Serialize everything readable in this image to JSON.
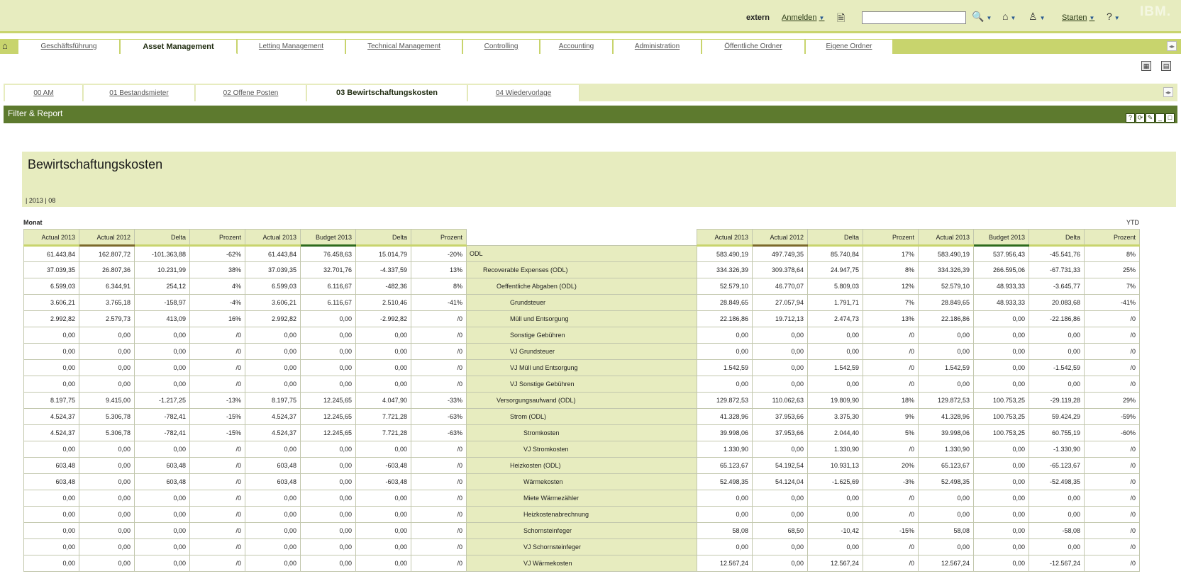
{
  "header": {
    "user": "extern",
    "login_label": "Anmelden",
    "search_value": "",
    "start_label": "Starten",
    "brand": "IBM."
  },
  "main_tabs": [
    {
      "label": "Geschäftsführung"
    },
    {
      "label": "Asset Management"
    },
    {
      "label": "Letting Management"
    },
    {
      "label": "Technical Management"
    },
    {
      "label": "Controlling"
    },
    {
      "label": "Accounting"
    },
    {
      "label": "Administration"
    },
    {
      "label": "Öffentliche Ordner"
    },
    {
      "label": "Eigene Ordner"
    }
  ],
  "active_main_tab": "Asset Management",
  "sub_tabs": [
    {
      "label": "00 AM"
    },
    {
      "label": "01 Bestandsmieter"
    },
    {
      "label": "02 Offene Posten"
    },
    {
      "label": "03 Bewirtschaftungskosten"
    },
    {
      "label": "04 Wiedervorlage"
    }
  ],
  "active_sub_tab": "03 Bewirtschaftungskosten",
  "portlet": {
    "title": "Filter & Report",
    "buttons": [
      "?",
      "⟳",
      "✎",
      "_",
      "□"
    ]
  },
  "report": {
    "title": "Bewirtschaftungskosten",
    "context": "| 2013 | 08",
    "monat_label": "Monat",
    "ytd_label": "YTD"
  },
  "columns": {
    "left": [
      "Actual 2013",
      "Actual 2012",
      "Delta",
      "Prozent",
      "Actual 2013",
      "Budget 2013",
      "Delta",
      "Prozent"
    ],
    "right": [
      "Actual 2013",
      "Actual 2012",
      "Delta",
      "Prozent",
      "Actual 2013",
      "Budget 2013",
      "Delta",
      "Prozent"
    ]
  },
  "rows": [
    {
      "label": "ODL",
      "indent": 0,
      "left": [
        "61.443,84",
        "162.807,72",
        "-101.363,88",
        "-62%",
        "61.443,84",
        "76.458,63",
        "15.014,79",
        "-20%"
      ],
      "right": [
        "583.490,19",
        "497.749,35",
        "85.740,84",
        "17%",
        "583.490,19",
        "537.956,43",
        "-45.541,76",
        "8%"
      ]
    },
    {
      "label": "Recoverable Expenses (ODL)",
      "indent": 1,
      "left": [
        "37.039,35",
        "26.807,36",
        "10.231,99",
        "38%",
        "37.039,35",
        "32.701,76",
        "-4.337,59",
        "13%"
      ],
      "right": [
        "334.326,39",
        "309.378,64",
        "24.947,75",
        "8%",
        "334.326,39",
        "266.595,06",
        "-67.731,33",
        "25%"
      ]
    },
    {
      "label": "Oeffentliche Abgaben (ODL)",
      "indent": 2,
      "left": [
        "6.599,03",
        "6.344,91",
        "254,12",
        "4%",
        "6.599,03",
        "6.116,67",
        "-482,36",
        "8%"
      ],
      "right": [
        "52.579,10",
        "46.770,07",
        "5.809,03",
        "12%",
        "52.579,10",
        "48.933,33",
        "-3.645,77",
        "7%"
      ]
    },
    {
      "label": "Grundsteuer",
      "indent": 3,
      "left": [
        "3.606,21",
        "3.765,18",
        "-158,97",
        "-4%",
        "3.606,21",
        "6.116,67",
        "2.510,46",
        "-41%"
      ],
      "right": [
        "28.849,65",
        "27.057,94",
        "1.791,71",
        "7%",
        "28.849,65",
        "48.933,33",
        "20.083,68",
        "-41%"
      ]
    },
    {
      "label": "Müll und Entsorgung",
      "indent": 3,
      "left": [
        "2.992,82",
        "2.579,73",
        "413,09",
        "16%",
        "2.992,82",
        "0,00",
        "-2.992,82",
        "/0"
      ],
      "right": [
        "22.186,86",
        "19.712,13",
        "2.474,73",
        "13%",
        "22.186,86",
        "0,00",
        "-22.186,86",
        "/0"
      ]
    },
    {
      "label": "Sonstige Gebühren",
      "indent": 3,
      "left": [
        "0,00",
        "0,00",
        "0,00",
        "/0",
        "0,00",
        "0,00",
        "0,00",
        "/0"
      ],
      "right": [
        "0,00",
        "0,00",
        "0,00",
        "/0",
        "0,00",
        "0,00",
        "0,00",
        "/0"
      ]
    },
    {
      "label": "VJ Grundsteuer",
      "indent": 3,
      "left": [
        "0,00",
        "0,00",
        "0,00",
        "/0",
        "0,00",
        "0,00",
        "0,00",
        "/0"
      ],
      "right": [
        "0,00",
        "0,00",
        "0,00",
        "/0",
        "0,00",
        "0,00",
        "0,00",
        "/0"
      ]
    },
    {
      "label": "VJ Müll und Entsorgung",
      "indent": 3,
      "left": [
        "0,00",
        "0,00",
        "0,00",
        "/0",
        "0,00",
        "0,00",
        "0,00",
        "/0"
      ],
      "right": [
        "1.542,59",
        "0,00",
        "1.542,59",
        "/0",
        "1.542,59",
        "0,00",
        "-1.542,59",
        "/0"
      ]
    },
    {
      "label": "VJ Sonstige Gebühren",
      "indent": 3,
      "left": [
        "0,00",
        "0,00",
        "0,00",
        "/0",
        "0,00",
        "0,00",
        "0,00",
        "/0"
      ],
      "right": [
        "0,00",
        "0,00",
        "0,00",
        "/0",
        "0,00",
        "0,00",
        "0,00",
        "/0"
      ]
    },
    {
      "label": "Versorgungsaufwand (ODL)",
      "indent": 2,
      "left": [
        "8.197,75",
        "9.415,00",
        "-1.217,25",
        "-13%",
        "8.197,75",
        "12.245,65",
        "4.047,90",
        "-33%"
      ],
      "right": [
        "129.872,53",
        "110.062,63",
        "19.809,90",
        "18%",
        "129.872,53",
        "100.753,25",
        "-29.119,28",
        "29%"
      ]
    },
    {
      "label": "Strom (ODL)",
      "indent": 3,
      "left": [
        "4.524,37",
        "5.306,78",
        "-782,41",
        "-15%",
        "4.524,37",
        "12.245,65",
        "7.721,28",
        "-63%"
      ],
      "right": [
        "41.328,96",
        "37.953,66",
        "3.375,30",
        "9%",
        "41.328,96",
        "100.753,25",
        "59.424,29",
        "-59%"
      ]
    },
    {
      "label": "Stromkosten",
      "indent": 4,
      "left": [
        "4.524,37",
        "5.306,78",
        "-782,41",
        "-15%",
        "4.524,37",
        "12.245,65",
        "7.721,28",
        "-63%"
      ],
      "right": [
        "39.998,06",
        "37.953,66",
        "2.044,40",
        "5%",
        "39.998,06",
        "100.753,25",
        "60.755,19",
        "-60%"
      ]
    },
    {
      "label": "VJ Stromkosten",
      "indent": 4,
      "left": [
        "0,00",
        "0,00",
        "0,00",
        "/0",
        "0,00",
        "0,00",
        "0,00",
        "/0"
      ],
      "right": [
        "1.330,90",
        "0,00",
        "1.330,90",
        "/0",
        "1.330,90",
        "0,00",
        "-1.330,90",
        "/0"
      ]
    },
    {
      "label": "Heizkosten (ODL)",
      "indent": 3,
      "left": [
        "603,48",
        "0,00",
        "603,48",
        "/0",
        "603,48",
        "0,00",
        "-603,48",
        "/0"
      ],
      "right": [
        "65.123,67",
        "54.192,54",
        "10.931,13",
        "20%",
        "65.123,67",
        "0,00",
        "-65.123,67",
        "/0"
      ]
    },
    {
      "label": "Wärmekosten",
      "indent": 4,
      "left": [
        "603,48",
        "0,00",
        "603,48",
        "/0",
        "603,48",
        "0,00",
        "-603,48",
        "/0"
      ],
      "right": [
        "52.498,35",
        "54.124,04",
        "-1.625,69",
        "-3%",
        "52.498,35",
        "0,00",
        "-52.498,35",
        "/0"
      ]
    },
    {
      "label": "Miete Wärmezähler",
      "indent": 4,
      "left": [
        "0,00",
        "0,00",
        "0,00",
        "/0",
        "0,00",
        "0,00",
        "0,00",
        "/0"
      ],
      "right": [
        "0,00",
        "0,00",
        "0,00",
        "/0",
        "0,00",
        "0,00",
        "0,00",
        "/0"
      ]
    },
    {
      "label": "Heizkostenabrechnung",
      "indent": 4,
      "left": [
        "0,00",
        "0,00",
        "0,00",
        "/0",
        "0,00",
        "0,00",
        "0,00",
        "/0"
      ],
      "right": [
        "0,00",
        "0,00",
        "0,00",
        "/0",
        "0,00",
        "0,00",
        "0,00",
        "/0"
      ]
    },
    {
      "label": "Schornsteinfeger",
      "indent": 4,
      "left": [
        "0,00",
        "0,00",
        "0,00",
        "/0",
        "0,00",
        "0,00",
        "0,00",
        "/0"
      ],
      "right": [
        "58,08",
        "68,50",
        "-10,42",
        "-15%",
        "58,08",
        "0,00",
        "-58,08",
        "/0"
      ]
    },
    {
      "label": "VJ Schornsteinfeger",
      "indent": 4,
      "left": [
        "0,00",
        "0,00",
        "0,00",
        "/0",
        "0,00",
        "0,00",
        "0,00",
        "/0"
      ],
      "right": [
        "0,00",
        "0,00",
        "0,00",
        "/0",
        "0,00",
        "0,00",
        "0,00",
        "/0"
      ]
    },
    {
      "label": "VJ Wärmekosten",
      "indent": 4,
      "left": [
        "0,00",
        "0,00",
        "0,00",
        "/0",
        "0,00",
        "0,00",
        "0,00",
        "/0"
      ],
      "right": [
        "12.567,24",
        "0,00",
        "12.567,24",
        "/0",
        "12.567,24",
        "0,00",
        "-12.567,24",
        "/0"
      ]
    }
  ],
  "colors": {
    "topbar_bg": "#e7ecbf",
    "accent": "#c8d46d",
    "portlet_bar": "#5d7a2e",
    "budget_underline": "#2e6b1e",
    "prior_year_underline": "#7c6a2b"
  }
}
